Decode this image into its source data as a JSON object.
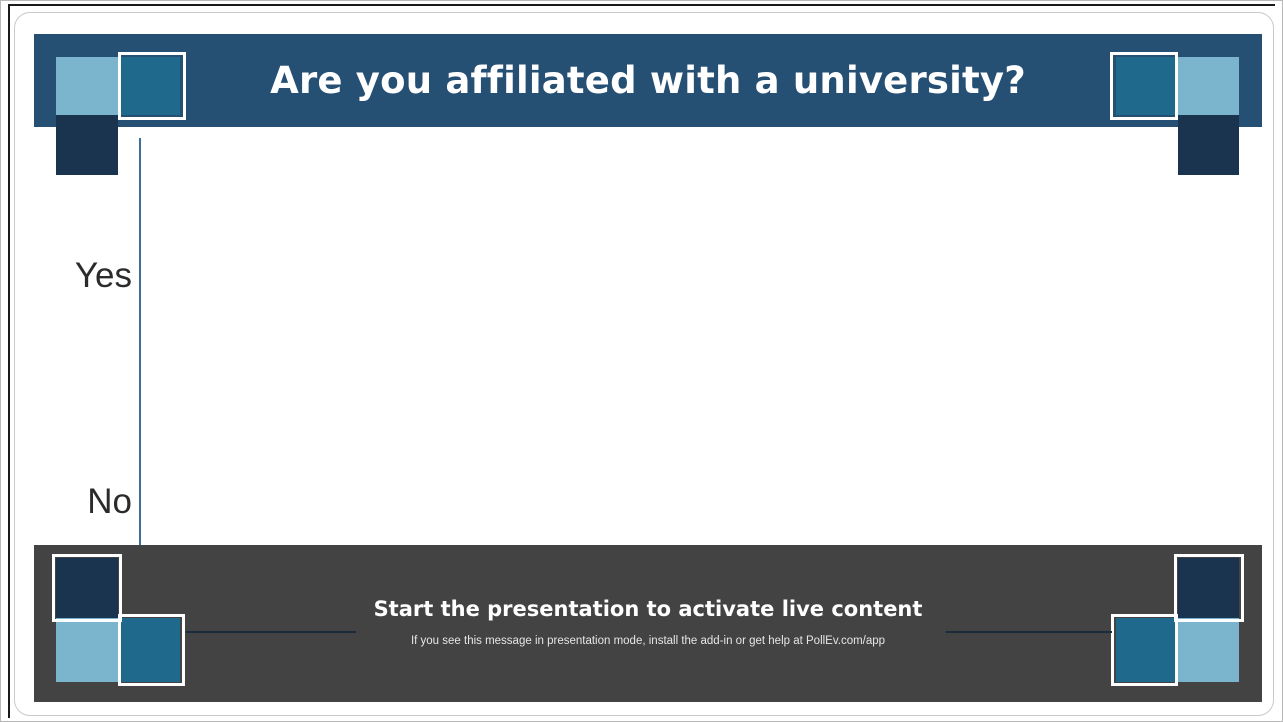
{
  "slide": {
    "title": "Are you affiliated with a university?",
    "categories": [
      "Yes",
      "No"
    ],
    "footer": {
      "headline": "Start the presentation to activate live content",
      "subtext": "If you see this message in presentation mode, install the add-in or get help at PollEv.com/app"
    }
  },
  "colors": {
    "header_bg": "#264f74",
    "footer_bg": "#434343",
    "square_light": "#7ab4cd",
    "square_mid": "#1f6a8c",
    "square_dark": "#1a3450"
  },
  "chart_data": {
    "type": "bar",
    "title": "Are you affiliated with a university?",
    "categories": [
      "Yes",
      "No"
    ],
    "values": []
  }
}
